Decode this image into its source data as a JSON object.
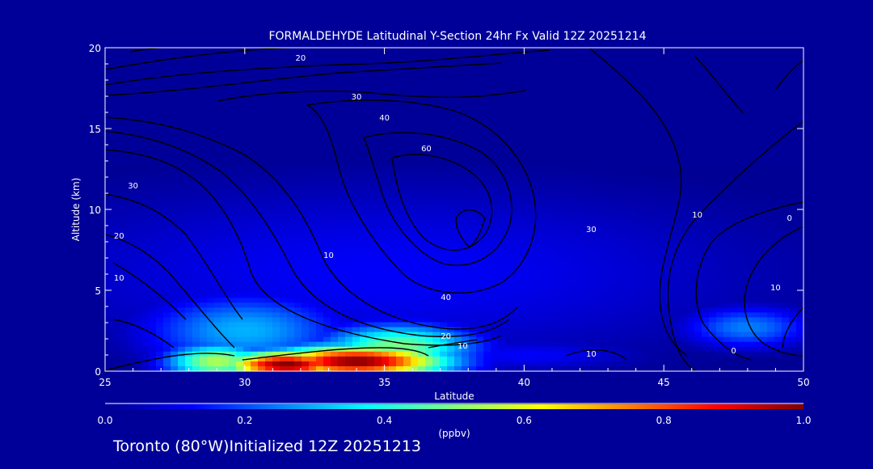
{
  "chart_data": {
    "type": "heatmap",
    "title": "FORMALDEHYDE Latitudinal Y-Section 24hr  Fx Valid 12Z 20251214",
    "xlabel": "Latitude",
    "ylabel": "Altitude (km)",
    "xlim": [
      25,
      50
    ],
    "ylim": [
      0,
      20
    ],
    "x_ticks": [
      "25",
      "30",
      "35",
      "40",
      "45",
      "50"
    ],
    "y_ticks": [
      "0",
      "5",
      "10",
      "15",
      "20"
    ],
    "colorbar": {
      "label": "(ppbv)",
      "range": [
        0.0,
        1.0
      ],
      "ticks": [
        "0.0",
        "0.2",
        "0.4",
        "0.6",
        "0.8",
        "1.0"
      ]
    },
    "field_blobs": [
      {
        "lat": 34.0,
        "alt": 0.6,
        "value": 1.0,
        "spread_lat": 2.3,
        "spread_alt": 0.7
      },
      {
        "lat": 31.5,
        "alt": 0.4,
        "value": 1.0,
        "spread_lat": 1.6,
        "spread_alt": 0.6
      },
      {
        "lat": 29.0,
        "alt": 0.6,
        "value": 0.55,
        "spread_lat": 1.3,
        "spread_alt": 0.8
      },
      {
        "lat": 35.5,
        "alt": 1.5,
        "value": 0.5,
        "spread_lat": 2.0,
        "spread_alt": 1.0
      },
      {
        "lat": 30.0,
        "alt": 2.5,
        "value": 0.3,
        "spread_lat": 2.5,
        "spread_alt": 1.6
      },
      {
        "lat": 48.0,
        "alt": 2.7,
        "value": 0.25,
        "spread_lat": 1.6,
        "spread_alt": 0.9
      },
      {
        "lat": 35.0,
        "alt": 6.0,
        "value": 0.12,
        "spread_lat": 10.0,
        "spread_alt": 4.0
      },
      {
        "lat": 40.0,
        "alt": 1.0,
        "value": 0.12,
        "spread_lat": 3.0,
        "spread_alt": 0.7
      }
    ],
    "background_value": 0.02,
    "data_top_alt": 12.7,
    "contour_labels": [
      {
        "text": "20",
        "lat": 32.0,
        "alt": 19.2
      },
      {
        "text": "30",
        "lat": 34.0,
        "alt": 16.8
      },
      {
        "text": "40",
        "lat": 35.0,
        "alt": 15.5
      },
      {
        "text": "60",
        "lat": 36.5,
        "alt": 13.6
      },
      {
        "text": "30",
        "lat": 26.0,
        "alt": 11.3
      },
      {
        "text": "20",
        "lat": 25.5,
        "alt": 8.2
      },
      {
        "text": "10",
        "lat": 25.5,
        "alt": 5.6
      },
      {
        "text": "10",
        "lat": 33.0,
        "alt": 7.0
      },
      {
        "text": "30",
        "lat": 42.4,
        "alt": 8.6
      },
      {
        "text": "40",
        "lat": 37.2,
        "alt": 4.4
      },
      {
        "text": "20",
        "lat": 37.2,
        "alt": 2.0
      },
      {
        "text": "10",
        "lat": 37.8,
        "alt": 1.4
      },
      {
        "text": "10",
        "lat": 42.4,
        "alt": 0.9
      },
      {
        "text": "10",
        "lat": 46.2,
        "alt": 9.5
      },
      {
        "text": "0",
        "lat": 49.5,
        "alt": 9.3
      },
      {
        "text": "10",
        "lat": 49.0,
        "alt": 5.0
      },
      {
        "text": "0",
        "lat": 47.5,
        "alt": 1.1
      }
    ]
  },
  "footer": {
    "text": "Toronto (80°W)Initialized 12Z 20251213"
  }
}
